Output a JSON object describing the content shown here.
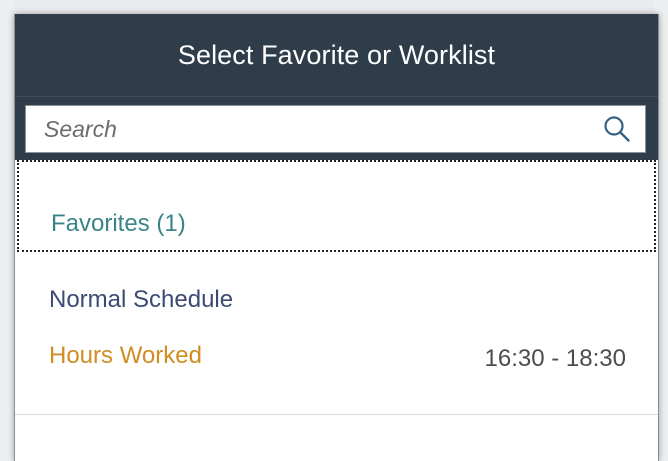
{
  "dialog": {
    "title": "Select Favorite or Worklist"
  },
  "search": {
    "placeholder": "Search",
    "value": "",
    "icon": "search-icon"
  },
  "favorites": {
    "group_label": "Favorites (1)",
    "items": [
      {
        "title": "Normal Schedule",
        "subtitle": "Hours Worked",
        "time_range": "16:30 - 18:30"
      }
    ]
  },
  "colors": {
    "header_bg": "#2f3d4b",
    "group_label": "#3a8487",
    "item_title": "#3c4a74",
    "item_subtitle": "#cf8d22"
  }
}
